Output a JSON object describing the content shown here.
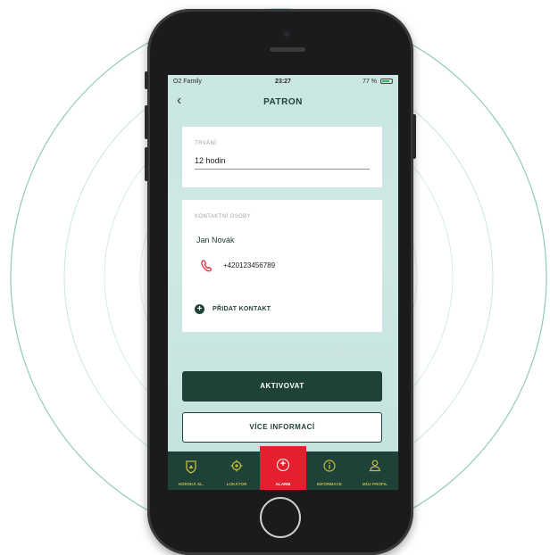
{
  "status_bar": {
    "carrier": "O2 Family",
    "time": "23:27",
    "battery": "77 %"
  },
  "header": {
    "back_icon": "chevron-left-icon",
    "title": "PATRON"
  },
  "duration": {
    "label": "TRVÁNÍ",
    "value": "12 hodin"
  },
  "contacts": {
    "label": "KONTAKTNÍ OSOBY",
    "items": [
      {
        "name": "Jan Novák",
        "phone": "+420123456789"
      }
    ],
    "add_label": "PŘIDAT KONTAKT"
  },
  "buttons": {
    "activate": "AKTIVOVAT",
    "more_info": "VÍCE INFORMACÍ"
  },
  "tabs": [
    {
      "label": "HORSKÁ SL.",
      "icon": "mountain-rescue-icon",
      "active": false
    },
    {
      "label": "LOKÁTOR",
      "icon": "locator-icon",
      "active": false
    },
    {
      "label": "ALARM",
      "icon": "alarm-plus-icon",
      "active": true
    },
    {
      "label": "INFORMACE",
      "icon": "info-icon",
      "active": false
    },
    {
      "label": "MŮJ PROFIL",
      "icon": "profile-icon",
      "active": false
    }
  ],
  "colors": {
    "primary": "#1f4238",
    "alarm": "#e4202f",
    "accent": "#c6bc45",
    "screen_bg": "#c9e6e2",
    "ring": "#8fc9c0"
  }
}
